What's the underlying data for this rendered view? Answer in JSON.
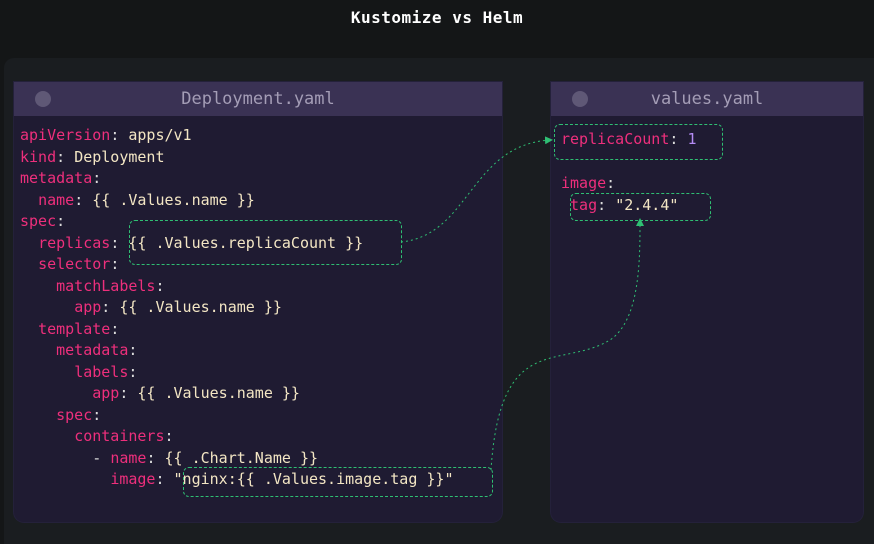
{
  "title": "Kustomize vs Helm",
  "deployment": {
    "filename": "Deployment.yaml",
    "lines": [
      {
        "indent": 0,
        "key": "apiVersion",
        "sep": ": ",
        "value": "apps/v1"
      },
      {
        "indent": 0,
        "key": "kind",
        "sep": ": ",
        "value": "Deployment"
      },
      {
        "indent": 0,
        "key": "metadata",
        "sep": ":",
        "value": ""
      },
      {
        "indent": 1,
        "key": "name",
        "sep": ": ",
        "value": "{{ .Values.name }}"
      },
      {
        "indent": 0,
        "key": "spec",
        "sep": ":",
        "value": ""
      },
      {
        "indent": 1,
        "key": "replicas",
        "sep": ": ",
        "value": "{{ .Values.replicaCount }}"
      },
      {
        "indent": 1,
        "key": "selector",
        "sep": ":",
        "value": ""
      },
      {
        "indent": 2,
        "key": "matchLabels",
        "sep": ":",
        "value": ""
      },
      {
        "indent": 3,
        "key": "app",
        "sep": ": ",
        "value": "{{ .Values.name }}"
      },
      {
        "indent": 1,
        "key": "template",
        "sep": ":",
        "value": ""
      },
      {
        "indent": 2,
        "key": "metadata",
        "sep": ":",
        "value": ""
      },
      {
        "indent": 3,
        "key": "labels",
        "sep": ":",
        "value": ""
      },
      {
        "indent": 4,
        "key": "app",
        "sep": ": ",
        "value": "{{ .Values.name }}"
      },
      {
        "indent": 2,
        "key": "spec",
        "sep": ":",
        "value": ""
      },
      {
        "indent": 3,
        "key": "containers",
        "sep": ":",
        "value": ""
      },
      {
        "indent": 4,
        "prefix": "- ",
        "key": "name",
        "sep": ": ",
        "value": "{{ .Chart.Name }}"
      },
      {
        "indent": 5,
        "key": "image",
        "sep": ": ",
        "value": "\"nginx:{{ .Values.image.tag }}\""
      }
    ]
  },
  "values": {
    "filename": "values.yaml",
    "lines": [
      {
        "key": "replicaCount",
        "sep": ": ",
        "value": "1"
      },
      {
        "key": "image",
        "sep": ":",
        "value": ""
      },
      {
        "key": "tag",
        "sep": ": ",
        "value": "\"2.4.4\""
      }
    ]
  },
  "colors": {
    "key": "#ee2f7c",
    "value": "#f3e6c4",
    "number": "#b58cf5",
    "highlight": "#2fbf73",
    "panel": "#1f1b32",
    "panel_header": "#3a3254"
  }
}
